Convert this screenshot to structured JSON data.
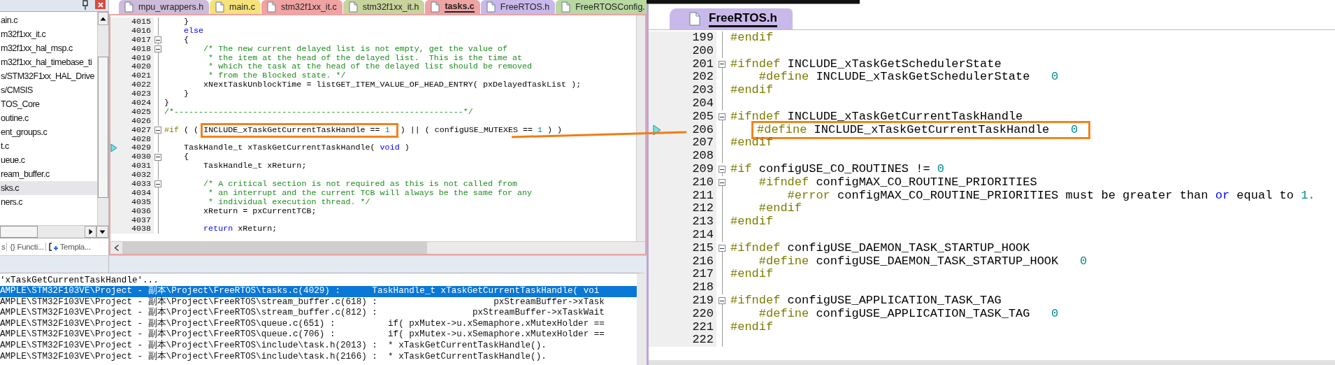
{
  "project_panel": {
    "items": [
      {
        "label": "ain.c",
        "selected": false
      },
      {
        "label": "m32f1xx_it.c",
        "selected": false
      },
      {
        "label": "m32f1xx_hal_msp.c",
        "selected": false
      },
      {
        "label": "m32f1xx_hal_timebase_ti",
        "selected": false
      },
      {
        "label": "s/STM32F1xx_HAL_Drive",
        "selected": false
      },
      {
        "label": "s/CMSIS",
        "selected": false
      },
      {
        "label": "TOS_Core",
        "selected": false
      },
      {
        "label": "outine.c",
        "selected": false
      },
      {
        "label": "ent_groups.c",
        "selected": false
      },
      {
        "label": "t.c",
        "selected": false
      },
      {
        "label": "ueue.c",
        "selected": false
      },
      {
        "label": "ream_buffer.c",
        "selected": false
      },
      {
        "label": "sks.c",
        "selected": true
      },
      {
        "label": "ners.c",
        "selected": false
      }
    ],
    "bottom_tabs": [
      {
        "label": "s",
        "kind": "plain"
      },
      {
        "label": "{} Functi...",
        "kind": "plain"
      },
      {
        "label": "Templa...",
        "kind": "template"
      }
    ]
  },
  "editor": {
    "tabs": [
      {
        "label": "mpu_wrappers.h",
        "color": "#cdbbd9",
        "selected": false
      },
      {
        "label": "main.c",
        "color": "#f5e27c",
        "selected": false
      },
      {
        "label": "stm32f1xx_it.c",
        "color": "#efa3a3",
        "selected": false
      },
      {
        "label": "stm32f1xx_it.h",
        "color": "#c8d49c",
        "selected": false
      },
      {
        "label": "tasks.c",
        "color": "#efa3a3",
        "selected": true
      },
      {
        "label": "FreeRTOS.h",
        "color": "#c9b9ea",
        "selected": false
      },
      {
        "label": "FreeRTOSConfig.",
        "color": "#b9d8a2",
        "selected": false
      }
    ],
    "lines": [
      {
        "number": "4015",
        "collapsible": false,
        "marker": false,
        "tokens": [
          {
            "kind": "plain",
            "text": "    }"
          }
        ]
      },
      {
        "number": "4016",
        "collapsible": false,
        "marker": false,
        "tokens": [
          {
            "kind": "keyword",
            "text": "    else"
          }
        ]
      },
      {
        "number": "4017",
        "collapsible": true,
        "marker": false,
        "tokens": [
          {
            "kind": "plain",
            "text": "    {"
          }
        ]
      },
      {
        "number": "4018",
        "collapsible": true,
        "marker": false,
        "tokens": [
          {
            "kind": "comment",
            "text": "        /* The new current delayed list is not empty, get the value of"
          }
        ]
      },
      {
        "number": "4019",
        "collapsible": false,
        "marker": false,
        "tokens": [
          {
            "kind": "comment",
            "text": "         * the item at the head of the delayed list.  This is the time at"
          }
        ]
      },
      {
        "number": "4020",
        "collapsible": false,
        "marker": false,
        "tokens": [
          {
            "kind": "comment",
            "text": "         * which the task at the head of the delayed list should be removed"
          }
        ]
      },
      {
        "number": "4021",
        "collapsible": false,
        "marker": false,
        "tokens": [
          {
            "kind": "comment",
            "text": "         * from the Blocked state. */"
          }
        ]
      },
      {
        "number": "4022",
        "collapsible": false,
        "marker": false,
        "tokens": [
          {
            "kind": "plain",
            "text": "        xNextTaskUnblockTime = listGET_ITEM_VALUE_OF_HEAD_ENTRY( pxDelayedTaskList );"
          }
        ]
      },
      {
        "number": "4023",
        "collapsible": false,
        "marker": false,
        "tokens": [
          {
            "kind": "plain",
            "text": "    }"
          }
        ]
      },
      {
        "number": "4024",
        "collapsible": false,
        "marker": false,
        "tokens": [
          {
            "kind": "plain",
            "text": "}"
          }
        ]
      },
      {
        "number": "4025",
        "collapsible": false,
        "marker": false,
        "tokens": [
          {
            "kind": "comment",
            "text": "/*-----------------------------------------------------------*/"
          }
        ]
      },
      {
        "number": "4026",
        "collapsible": false,
        "marker": false
      },
      {
        "number": "4027",
        "collapsible": true,
        "marker": false,
        "tokens": [
          {
            "kind": "preproc",
            "text": "#if"
          },
          {
            "kind": "plain",
            "text": " ( ( "
          },
          {
            "kind": "plain",
            "text": "INCLUDE_xTaskGetCurrentTaskHandle == ",
            "boxed": true
          },
          {
            "kind": "number",
            "text": "1",
            "boxed": true
          },
          {
            "kind": "plain",
            "text": " ) || ( configUSE_MUTEXES == "
          },
          {
            "kind": "number",
            "text": "1"
          },
          {
            "kind": "plain",
            "text": " ) )"
          }
        ]
      },
      {
        "number": "4028",
        "collapsible": false,
        "marker": false
      },
      {
        "number": "4029",
        "collapsible": false,
        "marker": true,
        "tokens": [
          {
            "kind": "plain",
            "text": "    TaskHandle_t xTaskGetCurrentTaskHandle( "
          },
          {
            "kind": "keyword",
            "text": "void"
          },
          {
            "kind": "plain",
            "text": " )"
          }
        ]
      },
      {
        "number": "4030",
        "collapsible": true,
        "marker": false,
        "tokens": [
          {
            "kind": "plain",
            "text": "    {"
          }
        ]
      },
      {
        "number": "4031",
        "collapsible": false,
        "marker": false,
        "tokens": [
          {
            "kind": "plain",
            "text": "        TaskHandle_t xReturn;"
          }
        ]
      },
      {
        "number": "4032",
        "collapsible": false,
        "marker": false
      },
      {
        "number": "4033",
        "collapsible": true,
        "marker": false,
        "tokens": [
          {
            "kind": "comment",
            "text": "        /* A critical section is not required as this is not called from"
          }
        ]
      },
      {
        "number": "4034",
        "collapsible": false,
        "marker": false,
        "tokens": [
          {
            "kind": "comment",
            "text": "         * an interrupt and the current TCB will always be the same for any"
          }
        ]
      },
      {
        "number": "4035",
        "collapsible": false,
        "marker": false,
        "tokens": [
          {
            "kind": "comment",
            "text": "         * individual execution thread. */"
          }
        ]
      },
      {
        "number": "4036",
        "collapsible": false,
        "marker": false,
        "tokens": [
          {
            "kind": "plain",
            "text": "        xReturn = pxCurrentTCB;"
          }
        ]
      },
      {
        "number": "4037",
        "collapsible": false,
        "marker": false
      },
      {
        "number": "4038",
        "collapsible": false,
        "marker": false,
        "tokens": [
          {
            "kind": "keyword",
            "text": "        return"
          },
          {
            "kind": "plain",
            "text": " xReturn;"
          }
        ]
      }
    ]
  },
  "find_results": {
    "query": "'xTaskGetCurrentTaskHandle'...",
    "rows": [
      {
        "text": "AMPLE\\STM32F103VE\\Project - 副本\\Project\\FreeRTOS\\tasks.c(4029) :      TaskHandle_t xTaskGetCurrentTaskHandle( voi",
        "selected": true
      },
      {
        "text": "AMPLE\\STM32F103VE\\Project - 副本\\Project\\FreeRTOS\\stream_buffer.c(618) :                      pxStreamBuffer->xTask",
        "selected": false
      },
      {
        "text": "AMPLE\\STM32F103VE\\Project - 副本\\Project\\FreeRTOS\\stream_buffer.c(812) :                  pxStreamBuffer->xTaskWait",
        "selected": false
      },
      {
        "text": "AMPLE\\STM32F103VE\\Project - 副本\\Project\\FreeRTOS\\queue.c(651) :          if( pxMutex->u.xSemaphore.xMutexHolder ==",
        "selected": false
      },
      {
        "text": "AMPLE\\STM32F103VE\\Project - 副本\\Project\\FreeRTOS\\queue.c(706) :          if( pxMutex->u.xSemaphore.xMutexHolder ==",
        "selected": false
      },
      {
        "text": "AMPLE\\STM32F103VE\\Project - 副本\\Project\\FreeRTOS\\include\\task.h(2013) :  * xTaskGetCurrentTaskHandle().",
        "selected": false
      },
      {
        "text": "AMPLE\\STM32F103VE\\Project - 副本\\Project\\FreeRTOS\\include\\task.h(2166) :  * xTaskGetCurrentTaskHandle().",
        "selected": false
      }
    ]
  },
  "second_editor": {
    "tab": {
      "label": "FreeRTOS.h",
      "selected": true
    },
    "lines": [
      {
        "number": "199",
        "collapsible": false,
        "marker": false,
        "tokens": [
          {
            "kind": "preproc",
            "text": "#endif"
          }
        ]
      },
      {
        "number": "200",
        "collapsible": false,
        "marker": false
      },
      {
        "number": "201",
        "collapsible": true,
        "marker": false,
        "tokens": [
          {
            "kind": "preproc",
            "text": "#ifndef"
          },
          {
            "kind": "plain",
            "text": " INCLUDE_xTaskGetSchedulerState"
          }
        ]
      },
      {
        "number": "202",
        "collapsible": false,
        "marker": false,
        "tokens": [
          {
            "kind": "preproc",
            "text": "    #define"
          },
          {
            "kind": "plain",
            "text": " INCLUDE_xTaskGetSchedulerState   "
          },
          {
            "kind": "number",
            "text": "0"
          }
        ]
      },
      {
        "number": "203",
        "collapsible": false,
        "marker": false,
        "tokens": [
          {
            "kind": "preproc",
            "text": "#endif"
          }
        ]
      },
      {
        "number": "204",
        "collapsible": false,
        "marker": false
      },
      {
        "number": "205",
        "collapsible": true,
        "marker": false,
        "tokens": [
          {
            "kind": "preproc",
            "text": "#ifndef"
          },
          {
            "kind": "plain",
            "text": " INCLUDE_xTaskGetCurrentTaskHandle"
          }
        ]
      },
      {
        "number": "206",
        "collapsible": false,
        "marker": true,
        "tokens": [
          {
            "kind": "preproc",
            "text": "#define",
            "boxed": true
          },
          {
            "kind": "plain",
            "text": " INCLUDE_xTaskGetCurrentTaskHandle   ",
            "boxed": true
          },
          {
            "kind": "number",
            "text": "0",
            "boxed": true
          }
        ]
      },
      {
        "number": "207",
        "collapsible": false,
        "marker": false,
        "tokens": [
          {
            "kind": "preproc",
            "text": "#endif"
          }
        ]
      },
      {
        "number": "208",
        "collapsible": false,
        "marker": false
      },
      {
        "number": "209",
        "collapsible": true,
        "marker": false,
        "tokens": [
          {
            "kind": "preproc",
            "text": "#if"
          },
          {
            "kind": "plain",
            "text": " configUSE_CO_ROUTINES != "
          },
          {
            "kind": "number",
            "text": "0"
          }
        ]
      },
      {
        "number": "210",
        "collapsible": true,
        "marker": false,
        "tokens": [
          {
            "kind": "preproc",
            "text": "    #ifndef"
          },
          {
            "kind": "plain",
            "text": " configMAX_CO_ROUTINE_PRIORITIES"
          }
        ]
      },
      {
        "number": "211",
        "collapsible": false,
        "marker": false,
        "tokens": [
          {
            "kind": "preproc",
            "text": "        #error"
          },
          {
            "kind": "plain",
            "text": " configMAX_CO_ROUTINE_PRIORITIES must be greater than "
          },
          {
            "kind": "keyword",
            "text": "or"
          },
          {
            "kind": "plain",
            "text": " equal to "
          },
          {
            "kind": "number",
            "text": "1."
          }
        ]
      },
      {
        "number": "212",
        "collapsible": false,
        "marker": false,
        "tokens": [
          {
            "kind": "preproc",
            "text": "    #endif"
          }
        ]
      },
      {
        "number": "213",
        "collapsible": false,
        "marker": false,
        "tokens": [
          {
            "kind": "preproc",
            "text": "#endif"
          }
        ]
      },
      {
        "number": "214",
        "collapsible": false,
        "marker": false
      },
      {
        "number": "215",
        "collapsible": true,
        "marker": false,
        "tokens": [
          {
            "kind": "preproc",
            "text": "#ifndef"
          },
          {
            "kind": "plain",
            "text": " configUSE_DAEMON_TASK_STARTUP_HOOK"
          }
        ]
      },
      {
        "number": "216",
        "collapsible": false,
        "marker": false,
        "tokens": [
          {
            "kind": "preproc",
            "text": "    #define"
          },
          {
            "kind": "plain",
            "text": " configUSE_DAEMON_TASK_STARTUP_HOOK   "
          },
          {
            "kind": "number",
            "text": "0"
          }
        ]
      },
      {
        "number": "217",
        "collapsible": false,
        "marker": false,
        "tokens": [
          {
            "kind": "preproc",
            "text": "#endif"
          }
        ]
      },
      {
        "number": "218",
        "collapsible": false,
        "marker": false
      },
      {
        "number": "219",
        "collapsible": true,
        "marker": false,
        "tokens": [
          {
            "kind": "preproc",
            "text": "#ifndef"
          },
          {
            "kind": "plain",
            "text": " configUSE_APPLICATION_TASK_TAG"
          }
        ]
      },
      {
        "number": "220",
        "collapsible": false,
        "marker": false,
        "tokens": [
          {
            "kind": "preproc",
            "text": "    #define"
          },
          {
            "kind": "plain",
            "text": " configUSE_APPLICATION_TASK_TAG   "
          },
          {
            "kind": "number",
            "text": "0"
          }
        ]
      },
      {
        "number": "221",
        "collapsible": false,
        "marker": false,
        "tokens": [
          {
            "kind": "preproc",
            "text": "#endif"
          }
        ]
      },
      {
        "number": "222",
        "collapsible": false,
        "marker": false
      }
    ]
  }
}
